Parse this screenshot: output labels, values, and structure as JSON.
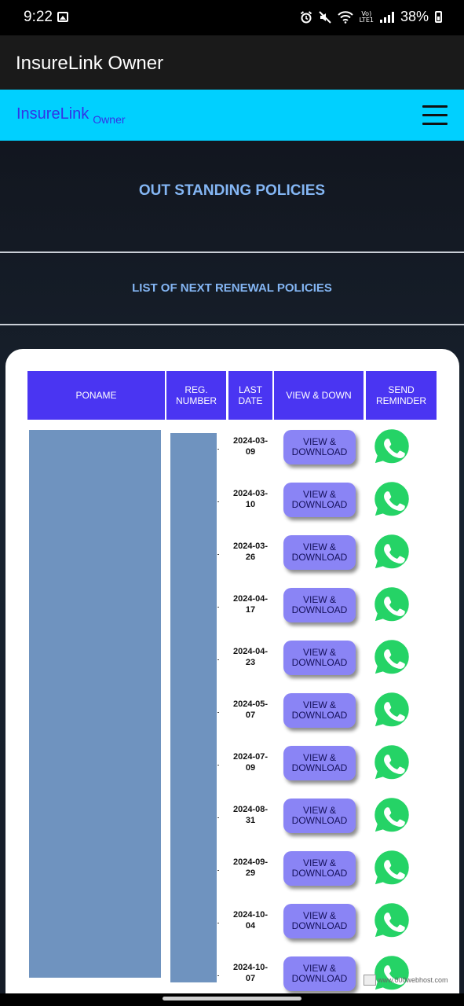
{
  "status_bar": {
    "time": "9:22",
    "icons": [
      "gallery-icon",
      "alarm-icon",
      "mute-icon",
      "wifi-icon",
      "volte-icon",
      "signal-icon"
    ],
    "volte_top": "Vo)",
    "volte_bottom": "LTE1",
    "battery_percent": "38%"
  },
  "app_bar": {
    "title": "InsureLink Owner"
  },
  "site_nav": {
    "brand": "InsureLink",
    "brand_sub": "Owner",
    "menu_icon": "hamburger-icon",
    "bg_color": "#00d0ff",
    "brand_color": "#3333e6"
  },
  "page": {
    "title": "OUT STANDING POLICIES",
    "subtitle": "LIST OF NEXT RENEWAL POLICIES",
    "title_color": "#84b6f4"
  },
  "table": {
    "header_color": "#4a35f2",
    "headers": {
      "poname": "PONAME",
      "reg_number": "REG. NUMBER",
      "last_date": "LAST DATE",
      "view_down": "VIEW & DOWN",
      "send_reminder": "SEND REMINDER"
    },
    "rows": [
      {
        "last_date": "2024-03-09",
        "action": "VIEW & DOWNLOAD"
      },
      {
        "last_date": "2024-03-10",
        "action": "VIEW & DOWNLOAD"
      },
      {
        "last_date": "2024-03-26",
        "action": "VIEW & DOWNLOAD"
      },
      {
        "last_date": "2024-04-17",
        "action": "VIEW & DOWNLOAD"
      },
      {
        "last_date": "2024-04-23",
        "action": "VIEW & DOWNLOAD"
      },
      {
        "last_date": "2024-05-07",
        "action": "VIEW & DOWNLOAD"
      },
      {
        "last_date": "2024-07-09",
        "action": "VIEW & DOWNLOAD"
      },
      {
        "last_date": "2024-08-31",
        "action": "VIEW & DOWNLOAD"
      },
      {
        "last_date": "2024-09-29",
        "action": "VIEW & DOWNLOAD"
      },
      {
        "last_date": "2024-10-04",
        "action": "VIEW & DOWNLOAD"
      },
      {
        "last_date": "2024-10-07",
        "action": "VIEW & DOWNLOAD"
      }
    ],
    "button_color": "#8a84f5",
    "reminder_icon": "whatsapp-icon",
    "whatsapp_color": "#25d366"
  },
  "watermark": {
    "text": "www.000webhost.com"
  }
}
